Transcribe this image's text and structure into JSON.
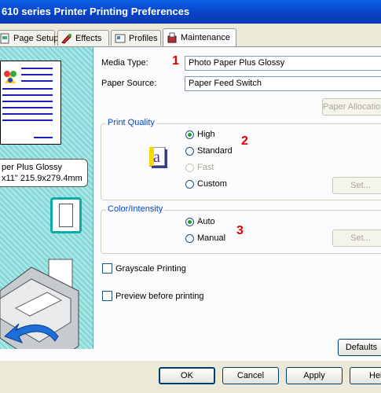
{
  "window": {
    "title": "610 series Printer Printing Preferences"
  },
  "tabs": [
    {
      "label": "Page Setup",
      "icon": "page-setup-icon"
    },
    {
      "label": "Effects",
      "icon": "effects-icon"
    },
    {
      "label": "Profiles",
      "icon": "profiles-icon"
    },
    {
      "label": "Maintenance",
      "icon": "maintenance-icon"
    }
  ],
  "preview": {
    "line1": "per Plus Glossy",
    "line2": "x11\" 215.9x279.4mm"
  },
  "main": {
    "media_type": {
      "label": "Media Type:",
      "value": "Photo Paper Plus Glossy",
      "marker": "1"
    },
    "paper_source": {
      "label": "Paper Source:",
      "value": "Paper Feed Switch"
    },
    "paper_allocation_label": "Paper Allocation..."
  },
  "print_quality": {
    "caption": "Print Quality",
    "options": [
      "High",
      "Standard",
      "Fast",
      "Custom"
    ],
    "selected": "High",
    "set_label": "Set...",
    "marker": "2"
  },
  "color_intensity": {
    "caption": "Color/Intensity",
    "options": [
      "Auto",
      "Manual"
    ],
    "selected": "Auto",
    "set_label": "Set...",
    "marker": "3"
  },
  "checkboxes": {
    "grayscale": "Grayscale Printing",
    "preview": "Preview before printing"
  },
  "buttons": {
    "defaults": "Defaults",
    "ok": "OK",
    "cancel": "Cancel",
    "apply": "Apply",
    "help": "Help"
  },
  "colors": {
    "accent": "#0046d5",
    "marker": "#e00000",
    "title_bar": "#0842c4"
  }
}
